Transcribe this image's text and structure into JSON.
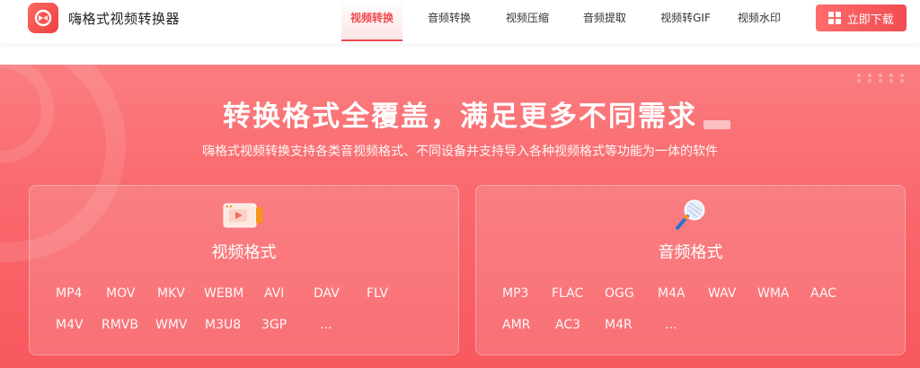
{
  "brand": {
    "name": "嗨格式视频转换器",
    "accent": "#ef4a4f"
  },
  "nav": {
    "items": [
      {
        "label": "视频转换",
        "active": true
      },
      {
        "label": "音频转换",
        "active": false
      },
      {
        "label": "视频压缩",
        "active": false
      },
      {
        "label": "音频提取",
        "active": false
      },
      {
        "label": "视频转GIF",
        "active": false
      },
      {
        "label": "视频水印",
        "active": false
      }
    ],
    "download_label": "立即下载",
    "download_icon": "windows-icon"
  },
  "hero": {
    "title": "转换格式全覆盖，满足更多不同需求",
    "subtitle": "嗨格式视频转换支持各类音视频格式、不同设备并支持导入各种视频格式等功能为一体的软件"
  },
  "cards": {
    "video": {
      "title": "视频格式",
      "icon": "video-play-icon",
      "formats": [
        "MP4",
        "MOV",
        "MKV",
        "WEBM",
        "AVI",
        "DAV",
        "FLV",
        "M4V",
        "RMVB",
        "WMV",
        "M3U8",
        "3GP",
        "..."
      ]
    },
    "audio": {
      "title": "音频格式",
      "icon": "microphone-icon",
      "formats": [
        "MP3",
        "FLAC",
        "OGG",
        "M4A",
        "WAV",
        "WMA",
        "AAC",
        "AMR",
        "AC3",
        "M4R",
        "..."
      ]
    }
  }
}
